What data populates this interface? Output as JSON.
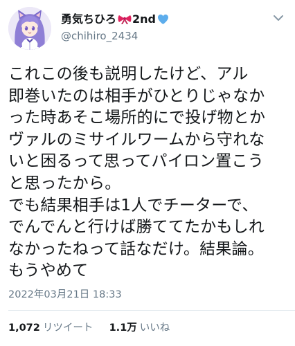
{
  "user": {
    "display_name": "勇気ちひろ",
    "display_suffix": "2nd",
    "handle": "@chihiro_2434"
  },
  "tweet": {
    "lines": [
      "これこの後も説明したけど、アル",
      "即巻いたのは相手がひとりじゃなか",
      "った時あそこ場所的にで投げ物とか",
      "ヴァルのミサイルワームから守れな",
      "いと困るって思ってパイロン置こう",
      "と思ったから。",
      "でも結果相手は1人でチーターで、",
      "でんでんと行けば勝ててたかもしれ",
      "なかったねって話なだけ。結果論。",
      "もうやめて"
    ],
    "timestamp": "2022年03月21日 18:33"
  },
  "stats": {
    "retweets_count": "1,072",
    "retweets_label": "リツイート",
    "likes_count": "1.1万",
    "likes_label": "いいね"
  },
  "icons": {
    "avatar": "anime-girl-avatar",
    "ribbon": "red-ribbon-emoji",
    "heart": "blue-heart-emoji",
    "more": "chevron-down-icon"
  },
  "colors": {
    "text": "#14171a",
    "secondary": "#657786",
    "divider": "#e1e8ed",
    "ribbon": "#e0245e",
    "heart": "#5dadec"
  }
}
